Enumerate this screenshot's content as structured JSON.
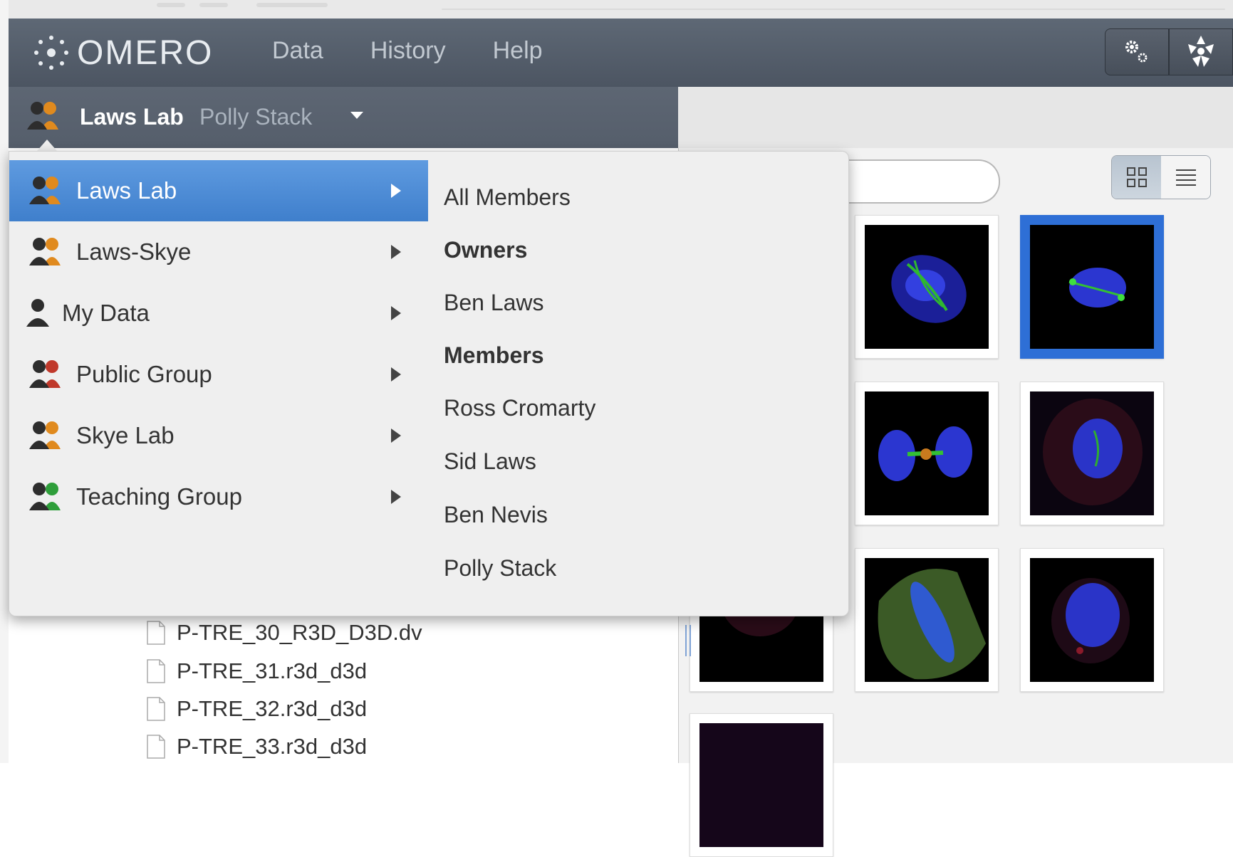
{
  "header": {
    "logo_text": "OMERO",
    "nav": [
      "Data",
      "History",
      "Help"
    ],
    "buttons": [
      "settings-icon",
      "apps-icon"
    ]
  },
  "group_bar": {
    "group_name": "Laws Lab",
    "user_name": "Polly Stack"
  },
  "dropdown": {
    "groups": [
      {
        "label": "Laws Lab",
        "icon": "group-orange-icon",
        "active": true
      },
      {
        "label": "Laws-Skye",
        "icon": "group-orange-icon"
      },
      {
        "label": "My Data",
        "icon": "user-icon"
      },
      {
        "label": "Public Group",
        "icon": "group-red-icon"
      },
      {
        "label": "Skye Lab",
        "icon": "group-orange-icon"
      },
      {
        "label": "Teaching Group",
        "icon": "group-green-icon"
      }
    ],
    "members": [
      {
        "label": "All Members"
      },
      {
        "label": "Owners",
        "heading": true
      },
      {
        "label": "Ben Laws"
      },
      {
        "label": "Members",
        "heading": true
      },
      {
        "label": "Ross Cromarty"
      },
      {
        "label": "Sid Laws"
      },
      {
        "label": "Ben Nevis"
      },
      {
        "label": "Polly Stack"
      }
    ]
  },
  "tree": {
    "files": [
      "P-TRE_30_R3D_D3D.dv",
      "P-TRE_31.r3d_d3d",
      "P-TRE_32.r3d_d3d",
      "P-TRE_33.r3d_d3d"
    ]
  },
  "colors": {
    "header": "#545d69",
    "active_item": "#4a89d6",
    "selected_thumb": "#2e6fd6",
    "group_orange": "#e08a1e",
    "group_red": "#c0392b",
    "group_green": "#2e9e3a"
  }
}
